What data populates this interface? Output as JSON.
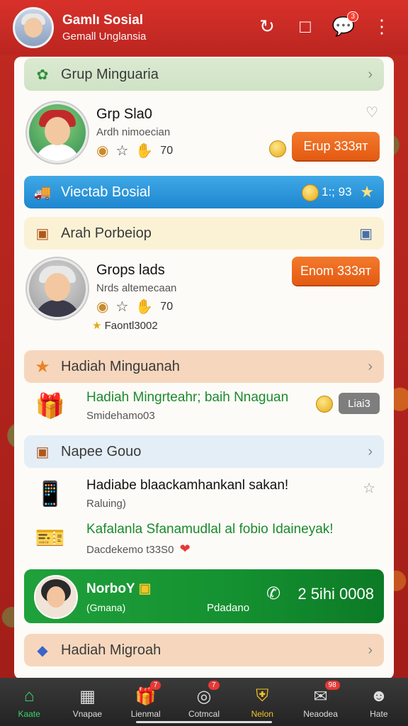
{
  "header": {
    "title": "Gamlı Sosial",
    "subtitle": "Gemall Unglansia",
    "icons": [
      "refresh-icon",
      "edit-icon",
      "chat-icon",
      "more-icon"
    ],
    "chat_badge": "3"
  },
  "sections": {
    "group_bar": {
      "label": "Grup Minguaria"
    },
    "profile1": {
      "name": "Grp Sla0",
      "sub": "Ardh nimoecian",
      "count": "70",
      "button": "Erup 333ят"
    },
    "social_bar": {
      "label": "Viectab Bosial",
      "value": "1:; 93"
    },
    "arah_bar": {
      "label": "Arah Porbeiop"
    },
    "profile2": {
      "name": "Grops lads",
      "sub": "Nrds altemecaan",
      "count": "70",
      "extra": "Faontl3002",
      "button": "Enom 333ят"
    },
    "hadiah_bar": {
      "label": "Hadiah Minguanah"
    },
    "reward1": {
      "title": "Hadiah Mingrteahr; baih Nnaguan",
      "sub": "Smidehamo03",
      "button": "Liai3"
    },
    "napee_bar": {
      "label": "Napee Gouo"
    },
    "reward2": {
      "title": "Hadiabe blaackamhankanl sakan!",
      "sub": "Raluing)"
    },
    "reward3": {
      "title": "Kafalanla Sfanamudlal al fobio Idaineyak!",
      "sub": "Dacdekemo t33S0"
    },
    "green_card": {
      "name": "NorboY",
      "sub": "(Gmana)",
      "mid": "Pdadano",
      "right": "2 5ihi 0008"
    },
    "hadiah_bar2": {
      "label": "Hadiah Migroah"
    }
  },
  "nav": {
    "items": [
      {
        "label": "Kaate",
        "icon": "home-icon"
      },
      {
        "label": "Vnapae",
        "icon": "cube-icon"
      },
      {
        "label": "Lienmal",
        "icon": "gift-icon",
        "badge": "7"
      },
      {
        "label": "Cotmcal",
        "icon": "target-icon",
        "badge": "7"
      },
      {
        "label": "Nelon",
        "icon": "shield-icon"
      },
      {
        "label": "Neaodea",
        "icon": "mail-icon",
        "badge": "98"
      },
      {
        "label": "Hate",
        "icon": "person-icon"
      }
    ]
  }
}
